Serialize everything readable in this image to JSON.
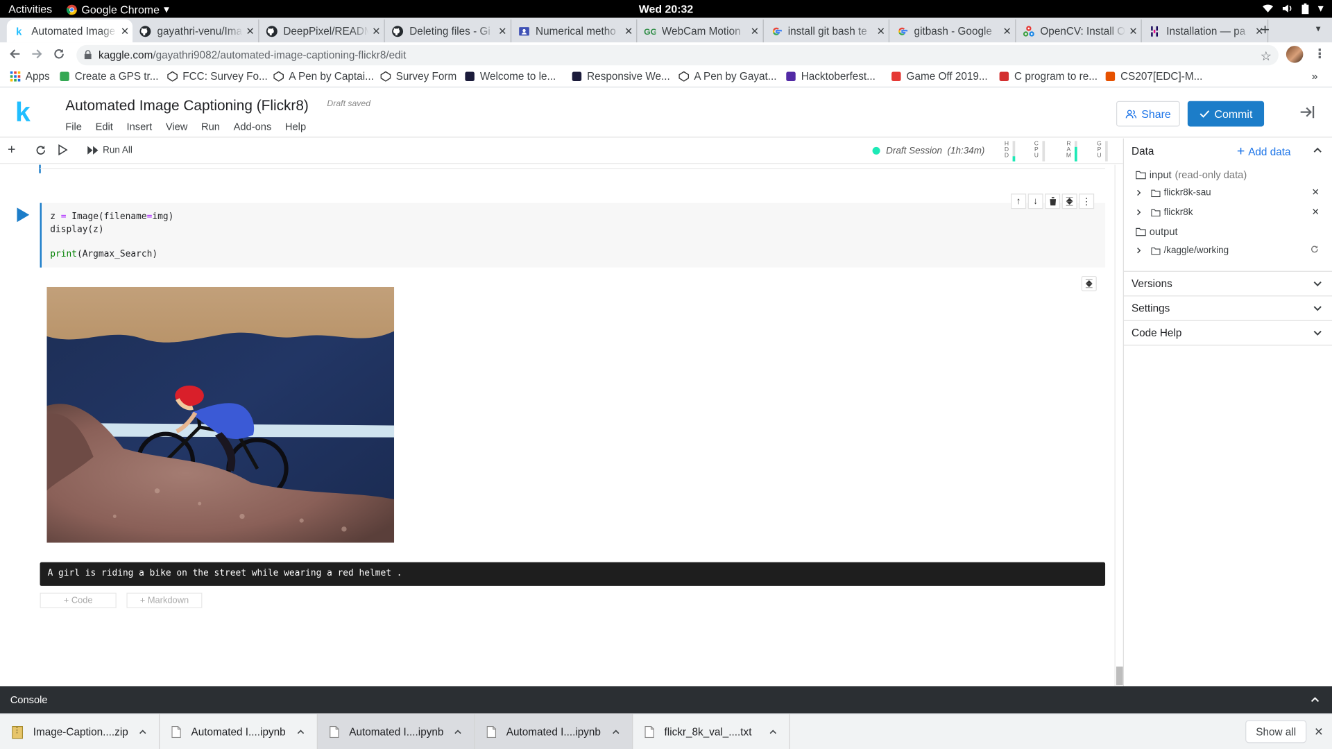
{
  "system": {
    "activities": "Activities",
    "app_name": "Google Chrome",
    "clock": "Wed 20:32"
  },
  "tabs": [
    {
      "title": "Automated Image",
      "favicon": "kaggle-icon",
      "active": true
    },
    {
      "title": "gayathri-venu/Ima",
      "favicon": "github-icon"
    },
    {
      "title": "DeepPixel/READM",
      "favicon": "github-icon"
    },
    {
      "title": "Deleting files - Gi",
      "favicon": "github-icon"
    },
    {
      "title": "Numerical metho",
      "favicon": "classroom-icon"
    },
    {
      "title": "WebCam Motion",
      "favicon": "gfg-icon"
    },
    {
      "title": "install git bash te",
      "favicon": "google-icon"
    },
    {
      "title": "gitbash - Google",
      "favicon": "google-icon"
    },
    {
      "title": "OpenCV: Install O",
      "favicon": "opencv-icon"
    },
    {
      "title": "Installation — pa",
      "favicon": "pandas-icon"
    }
  ],
  "url": {
    "host": "kaggle.com",
    "path": "/gayathri9082/automated-image-captioning-flickr8/edit"
  },
  "bookmarks": [
    "Apps",
    "Create a GPS tr...",
    "FCC: Survey Fo...",
    "A Pen by Captai...",
    "Survey Form",
    "Welcome to le...",
    "Responsive We...",
    "A Pen by Gayat...",
    "Hacktoberfest...",
    "Game Off 2019...",
    "C program to re...",
    "CS207[EDC]-M..."
  ],
  "kaggle": {
    "logo": "k",
    "title": "Automated Image Captioning (Flickr8)",
    "draft_status": "Draft saved",
    "menu": [
      "File",
      "Edit",
      "Insert",
      "View",
      "Run",
      "Add-ons",
      "Help"
    ],
    "share_label": "Share",
    "commit_label": "Commit",
    "run_all_label": "Run All",
    "session": {
      "label": "Draft Session",
      "time": "(1h:34m)"
    },
    "meters": [
      {
        "label": "HDD",
        "level": 0.25
      },
      {
        "label": "CPU",
        "level": 0.0
      },
      {
        "label": "RAM",
        "level": 0.7
      },
      {
        "label": "GPU",
        "level": 0.0
      }
    ]
  },
  "cell": {
    "code_line1_a": "z ",
    "code_line1_op": "=",
    "code_line1_b": " Image(filename",
    "code_line1_op2": "=",
    "code_line1_c": "img)",
    "code_line2": "display(z)",
    "code_line3_kw": "print",
    "code_line3_rest": "(Argmax_Search)",
    "output_text": "A girl is riding a bike on the street while wearing a red helmet .",
    "add_code_label": "+ Code",
    "add_markdown_label": "+ Markdown"
  },
  "data_panel": {
    "title": "Data",
    "add_data_label": "Add data",
    "input_label": "input",
    "input_note": "(read-only data)",
    "datasets": [
      "flickr8k-sau",
      "flickr8k"
    ],
    "output_label": "output",
    "working_dir": "/kaggle/working",
    "sections": [
      "Versions",
      "Settings",
      "Code Help"
    ]
  },
  "console": {
    "label": "Console"
  },
  "downloads": [
    {
      "name": "Image-Caption....zip",
      "icon": "zip-file-icon"
    },
    {
      "name": "Automated I....ipynb",
      "icon": "file-icon"
    },
    {
      "name": "Automated I....ipynb",
      "icon": "file-icon"
    },
    {
      "name": "Automated I....ipynb",
      "icon": "file-icon"
    },
    {
      "name": "flickr_8k_val_....txt",
      "icon": "file-icon"
    }
  ],
  "show_all_label": "Show all",
  "colors": {
    "kaggle_blue": "#20beff",
    "commit_blue": "#1c7dc9",
    "session_green": "#1de9b6"
  }
}
